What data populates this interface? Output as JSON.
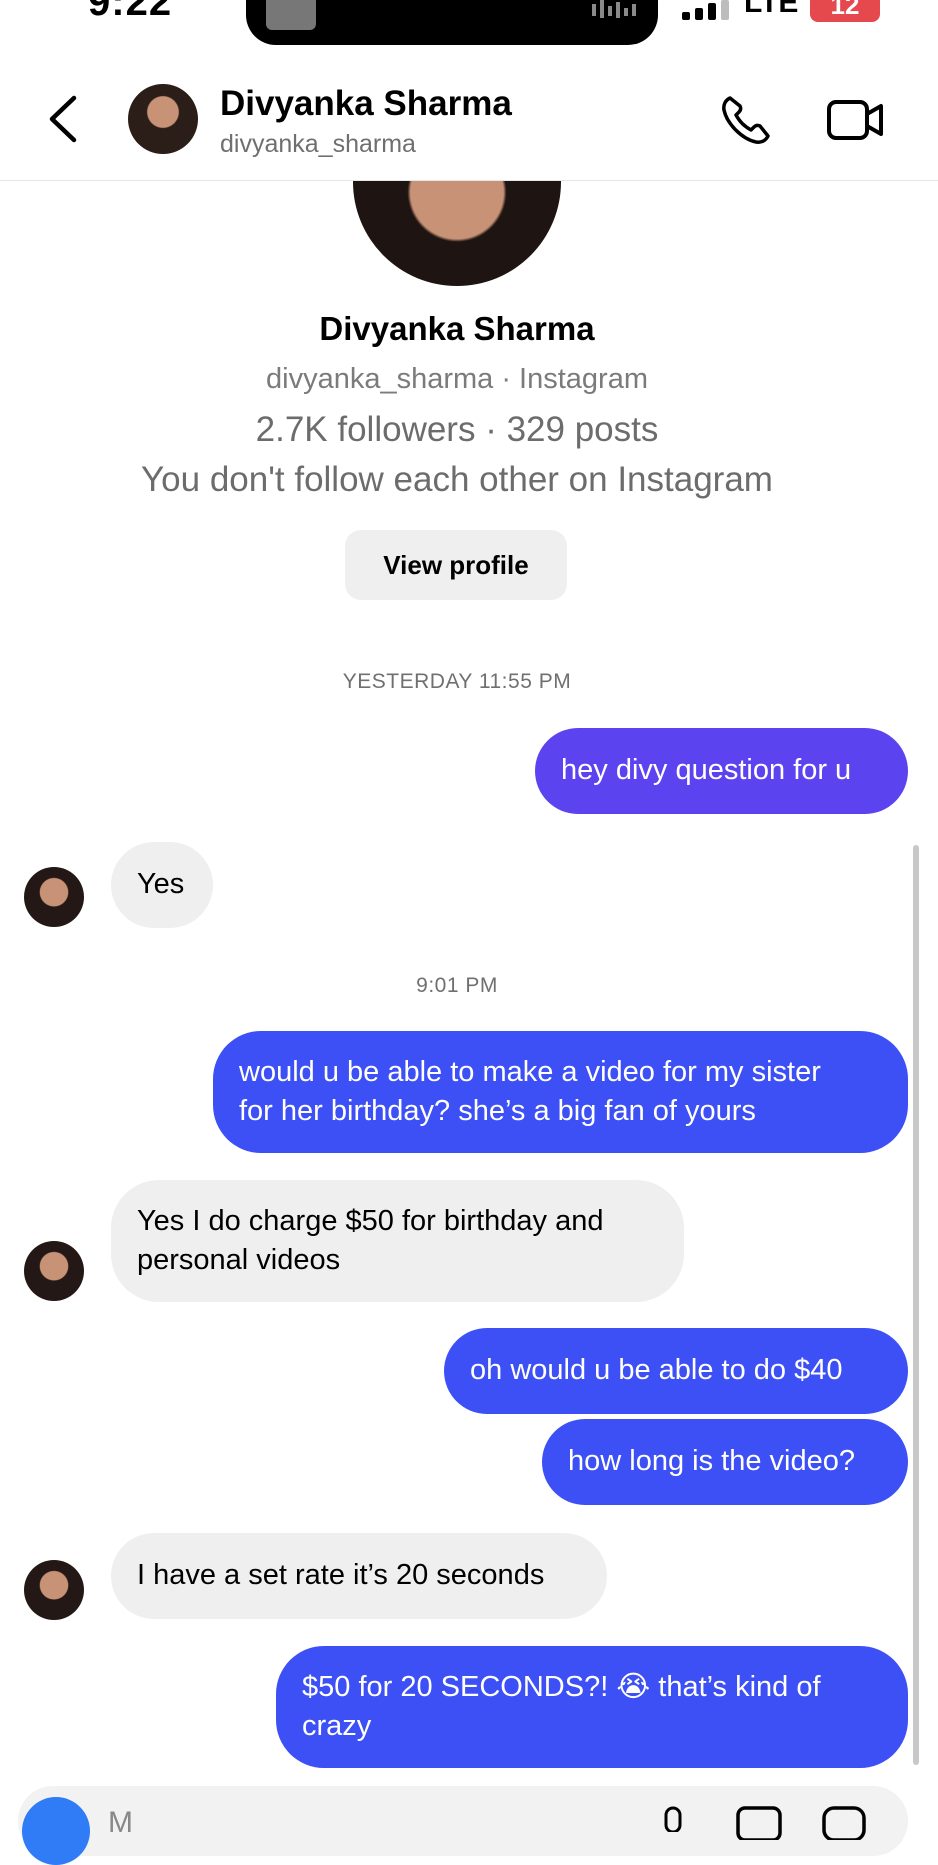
{
  "status_bar": {
    "time": "9:22",
    "network": "LTE",
    "battery": "12"
  },
  "header": {
    "name": "Divyanka Sharma",
    "username": "divyanka_sharma",
    "back_icon": "chevron-left-icon",
    "call_icon": "phone-icon",
    "video_icon": "video-camera-icon"
  },
  "profile": {
    "name": "Divyanka Sharma",
    "subtitle": "divyanka_sharma · Instagram",
    "stats": "2.7K followers · 329 posts",
    "follow_status": "You don't follow each other on Instagram",
    "view_profile_label": "View profile"
  },
  "timestamps": {
    "first": "YESTERDAY 11:55 PM",
    "second": "9:01 PM"
  },
  "messages": [
    {
      "direction": "outgoing",
      "lines": [
        "hey divy question for u"
      ]
    },
    {
      "direction": "incoming",
      "lines": [
        "Yes"
      ]
    },
    {
      "direction": "outgoing",
      "lines": [
        "would u be able to make a video for my sister",
        "for her birthday? she’s a big fan of yours"
      ]
    },
    {
      "direction": "incoming",
      "lines": [
        "Yes I do charge $50 for birthday and",
        "personal videos"
      ]
    },
    {
      "direction": "outgoing",
      "lines": [
        "oh would u be able to do $40"
      ]
    },
    {
      "direction": "outgoing",
      "lines": [
        "how long is the video?"
      ]
    },
    {
      "direction": "incoming",
      "lines": [
        "I have a set rate it’s 20 seconds"
      ]
    },
    {
      "direction": "outgoing",
      "lines": [
        "$50 for 20 SECONDS?! 😭 that’s kind of",
        "crazy"
      ]
    }
  ],
  "composer": {
    "placeholder": "M",
    "camera_icon": "camera-icon",
    "mic_icon": "microphone-icon",
    "gallery_icon": "gallery-icon",
    "sticker_icon": "sticker-icon"
  },
  "colors": {
    "outgoing_bubble": "#3d50f5",
    "outgoing_bubble_first": "#5b44f0",
    "incoming_bubble": "#efefef",
    "battery": "#e5484d"
  }
}
